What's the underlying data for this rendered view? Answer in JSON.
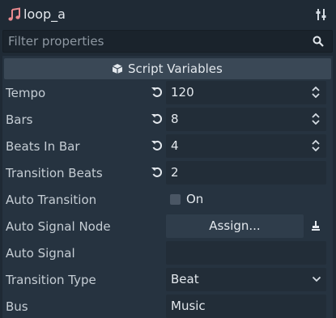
{
  "header": {
    "title": "loop_a",
    "title_icon": "music-note-icon",
    "menu_icon": "tune-sliders-icon"
  },
  "filter": {
    "placeholder": "Filter properties",
    "icon": "search-icon"
  },
  "section": {
    "label": "Script Variables",
    "icon": "cube-icon"
  },
  "properties": [
    {
      "label": "Tempo",
      "value": "120",
      "revert": true,
      "control": "spinbox"
    },
    {
      "label": "Bars",
      "value": "8",
      "revert": true,
      "control": "spinbox"
    },
    {
      "label": "Beats In Bar",
      "value": "4",
      "revert": true,
      "control": "spinbox"
    },
    {
      "label": "Transition Beats",
      "value": "2",
      "revert": true,
      "control": "text"
    },
    {
      "label": "Auto Transition",
      "value": "On",
      "checked": false,
      "control": "checkbox"
    },
    {
      "label": "Auto Signal Node",
      "value": "Assign...",
      "control": "node-path"
    },
    {
      "label": "Auto Signal",
      "value": "",
      "control": "text"
    },
    {
      "label": "Transition Type",
      "value": "Beat",
      "control": "dropdown"
    },
    {
      "label": "Bus",
      "value": "Music",
      "control": "text"
    }
  ],
  "colors": {
    "background": "#1f2a35",
    "panel": "#263340",
    "section": "#3a4856",
    "field": "#222d38",
    "title_icon": "#e88a8f"
  }
}
